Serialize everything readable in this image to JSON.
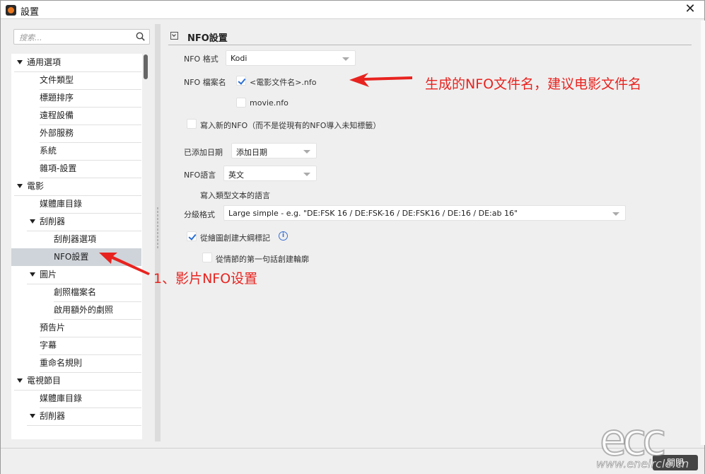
{
  "window": {
    "title": "設置",
    "close_glyph": "✕"
  },
  "search": {
    "placeholder": "搜索..."
  },
  "tree": [
    {
      "label": "通用選項",
      "expanded": true
    },
    {
      "label": "文件類型"
    },
    {
      "label": "標題排序"
    },
    {
      "label": "遠程設備"
    },
    {
      "label": "外部服務"
    },
    {
      "label": "系統"
    },
    {
      "label": "雜項-設置"
    },
    {
      "label": "電影",
      "expanded": true
    },
    {
      "label": "媒體庫目錄"
    },
    {
      "label": "刮削器",
      "expanded": true
    },
    {
      "label": "刮削器選項"
    },
    {
      "label": "NFO設置",
      "selected": true
    },
    {
      "label": "圖片",
      "expanded": true
    },
    {
      "label": "創照檔案名"
    },
    {
      "label": "啟用額外的劇照"
    },
    {
      "label": "預告片"
    },
    {
      "label": "字幕"
    },
    {
      "label": "重命名規則"
    },
    {
      "label": "電視節目",
      "expanded": true
    },
    {
      "label": "媒體庫目錄"
    },
    {
      "label": "刮削器",
      "expanded": true
    }
  ],
  "section": {
    "title": "NFO設置"
  },
  "form": {
    "nfo_format_label": "NFO 格式",
    "nfo_format_value": "Kodi",
    "nfo_filename_label": "NFO 檔案名",
    "nfo_filename_opt1": "<電影文件名>.nfo",
    "nfo_filename_opt2": "movie.nfo",
    "write_new_nfo": "寫入新的NFO（而不是從現有的NFO導入未知標籤）",
    "date_added_label": "已添加日期",
    "date_added_value": "添加日期",
    "nfo_lang_label": "NFO語言",
    "nfo_lang_value": "英文",
    "write_genre_text": "寫入類型文本的語言",
    "cert_format_label": "分級格式",
    "cert_format_value": "Large simple - e.g. \"DE:FSK 16 / DE:FSK-16 / DE:FSK16 / DE:16 / DE:ab 16\"",
    "create_outline": "從繪圖創建大綱標記",
    "first_sentence": "從情節的第一句話創建輪廓",
    "info_glyph": "i"
  },
  "annotations": {
    "note_filename": "生成的NFO文件名，建议电影文件名",
    "note_nfo": "1、影片NFO设置",
    "color": "#e8231f"
  },
  "bottom": {
    "close_label": "關閉"
  },
  "watermark": {
    "logo": "ecc",
    "url": "www.eneircle.cn"
  }
}
